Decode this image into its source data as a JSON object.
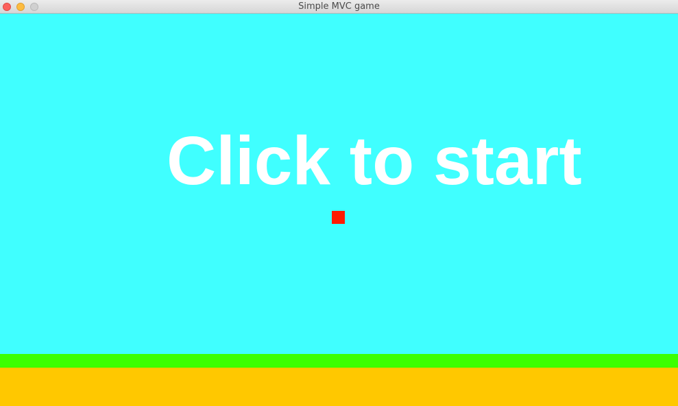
{
  "window": {
    "title": "Simple MVC game"
  },
  "game": {
    "message": "Click to start",
    "colors": {
      "sky": "#40ffff",
      "grass": "#3cff00",
      "ground": "#ffc800",
      "player": "#ff1a00",
      "message": "#ffffff"
    }
  }
}
